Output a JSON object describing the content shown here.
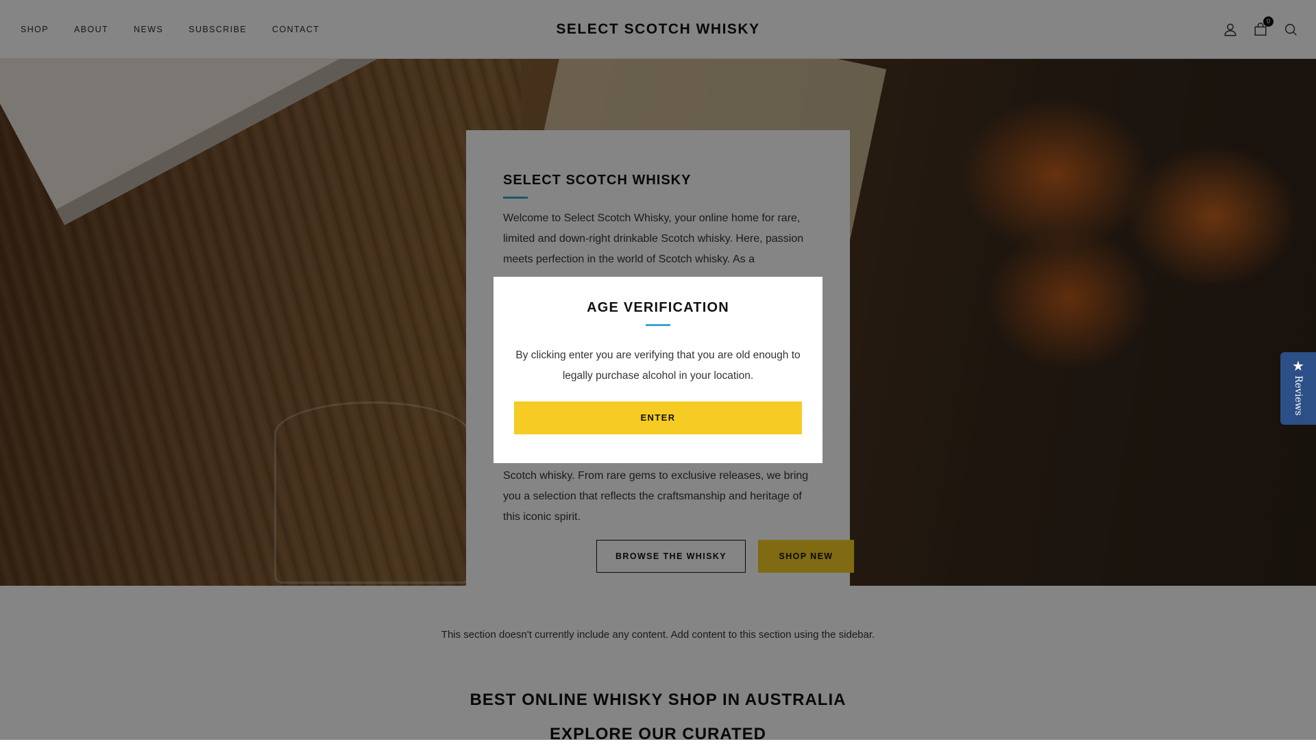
{
  "header": {
    "nav": [
      "SHOP",
      "ABOUT",
      "NEWS",
      "SUBSCRIBE",
      "CONTACT"
    ],
    "brand": "SELECT SCOTCH WHISKY",
    "cart_count": "0",
    "icons": [
      "account-icon",
      "cart-icon",
      "search-icon"
    ]
  },
  "hero_card": {
    "title": "SELECT SCOTCH WHISKY",
    "intro": "Welcome to Select Scotch Whisky, your online home for rare, limited and down-right drinkable Scotch whisky. Here, passion meets perfection in the world of Scotch whisky. As a",
    "outro": "Scotch whisky. From rare gems to exclusive releases, we bring you a selection that reflects the craftsmanship and heritage of this iconic spirit.",
    "browse_label": "BROWSE THE WHISKY",
    "shop_new_label": "SHOP NEW",
    "accent_color": "#3aa6d0",
    "button_color": "#f6cb23"
  },
  "modal": {
    "title": "AGE VERIFICATION",
    "text": "By clicking enter you are verifying that you are old enough to legally purchase alcohol in your location.",
    "enter_label": "ENTER"
  },
  "empty_section": {
    "text": "This section doesn't currently include any content. Add content to this section using the sidebar."
  },
  "lower": {
    "heading": "BEST ONLINE WHISKY SHOP IN AUSTRALIA",
    "subheading": "EXPLORE OUR CURATED"
  },
  "reviews_tab": {
    "label": "Reviews",
    "icon": "star-icon",
    "color": "#2b4f86"
  }
}
